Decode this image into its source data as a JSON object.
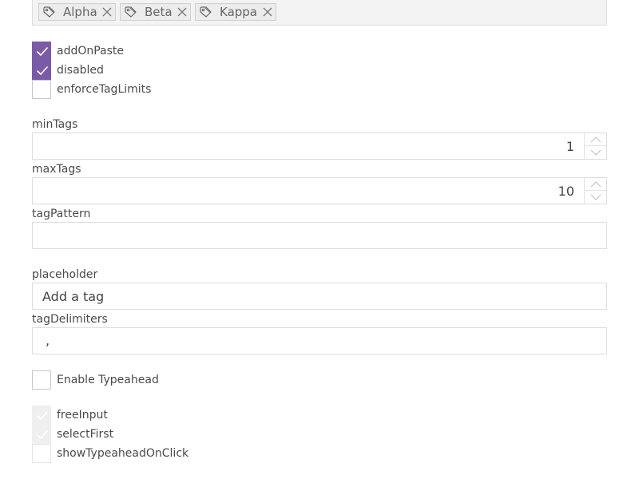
{
  "tags": [
    {
      "label": "Alpha"
    },
    {
      "label": "Beta"
    },
    {
      "label": "Kappa"
    }
  ],
  "options": {
    "add_on_paste": {
      "label": "addOnPaste",
      "checked": true
    },
    "disabled": {
      "label": "disabled",
      "checked": true
    },
    "enforce_tag_limits": {
      "label": "enforceTagLimits",
      "checked": false
    }
  },
  "fields": {
    "min_tags": {
      "label": "minTags",
      "value": "1"
    },
    "max_tags": {
      "label": "maxTags",
      "value": "10"
    },
    "tag_pattern": {
      "label": "tagPattern",
      "value": ""
    },
    "placeholder": {
      "label": "placeholder",
      "value": "Add a tag"
    },
    "tag_delimiters": {
      "label": "tagDelimiters",
      "value": ","
    }
  },
  "typeahead": {
    "enable": {
      "label": "Enable Typeahead",
      "checked": false
    },
    "free_input": {
      "label": "freeInput",
      "checked": true,
      "disabled": true
    },
    "select_first": {
      "label": "selectFirst",
      "checked": true,
      "disabled": true
    },
    "show_on_click": {
      "label": "showTypeaheadOnClick",
      "checked": false,
      "disabled": true
    }
  },
  "colors": {
    "accent": "#7a5ba8",
    "border": "#dddddd",
    "tag_bg": "#ececec"
  },
  "icons": {
    "tag": "tag-icon",
    "remove": "close-icon",
    "check": "check-icon",
    "spin_up": "chevron-up-icon",
    "spin_down": "chevron-down-icon"
  }
}
